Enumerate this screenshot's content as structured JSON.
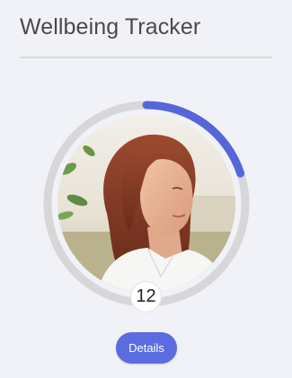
{
  "header": {
    "title": "Wellbeing Tracker"
  },
  "tracker": {
    "count": "12",
    "progress_fraction": 0.2,
    "ring_track_color": "#d7d7d9",
    "ring_progress_color": "#5566d9",
    "avatar_icon": "person-photo"
  },
  "actions": {
    "details_label": "Details",
    "accent_color": "#5b6ce0"
  }
}
